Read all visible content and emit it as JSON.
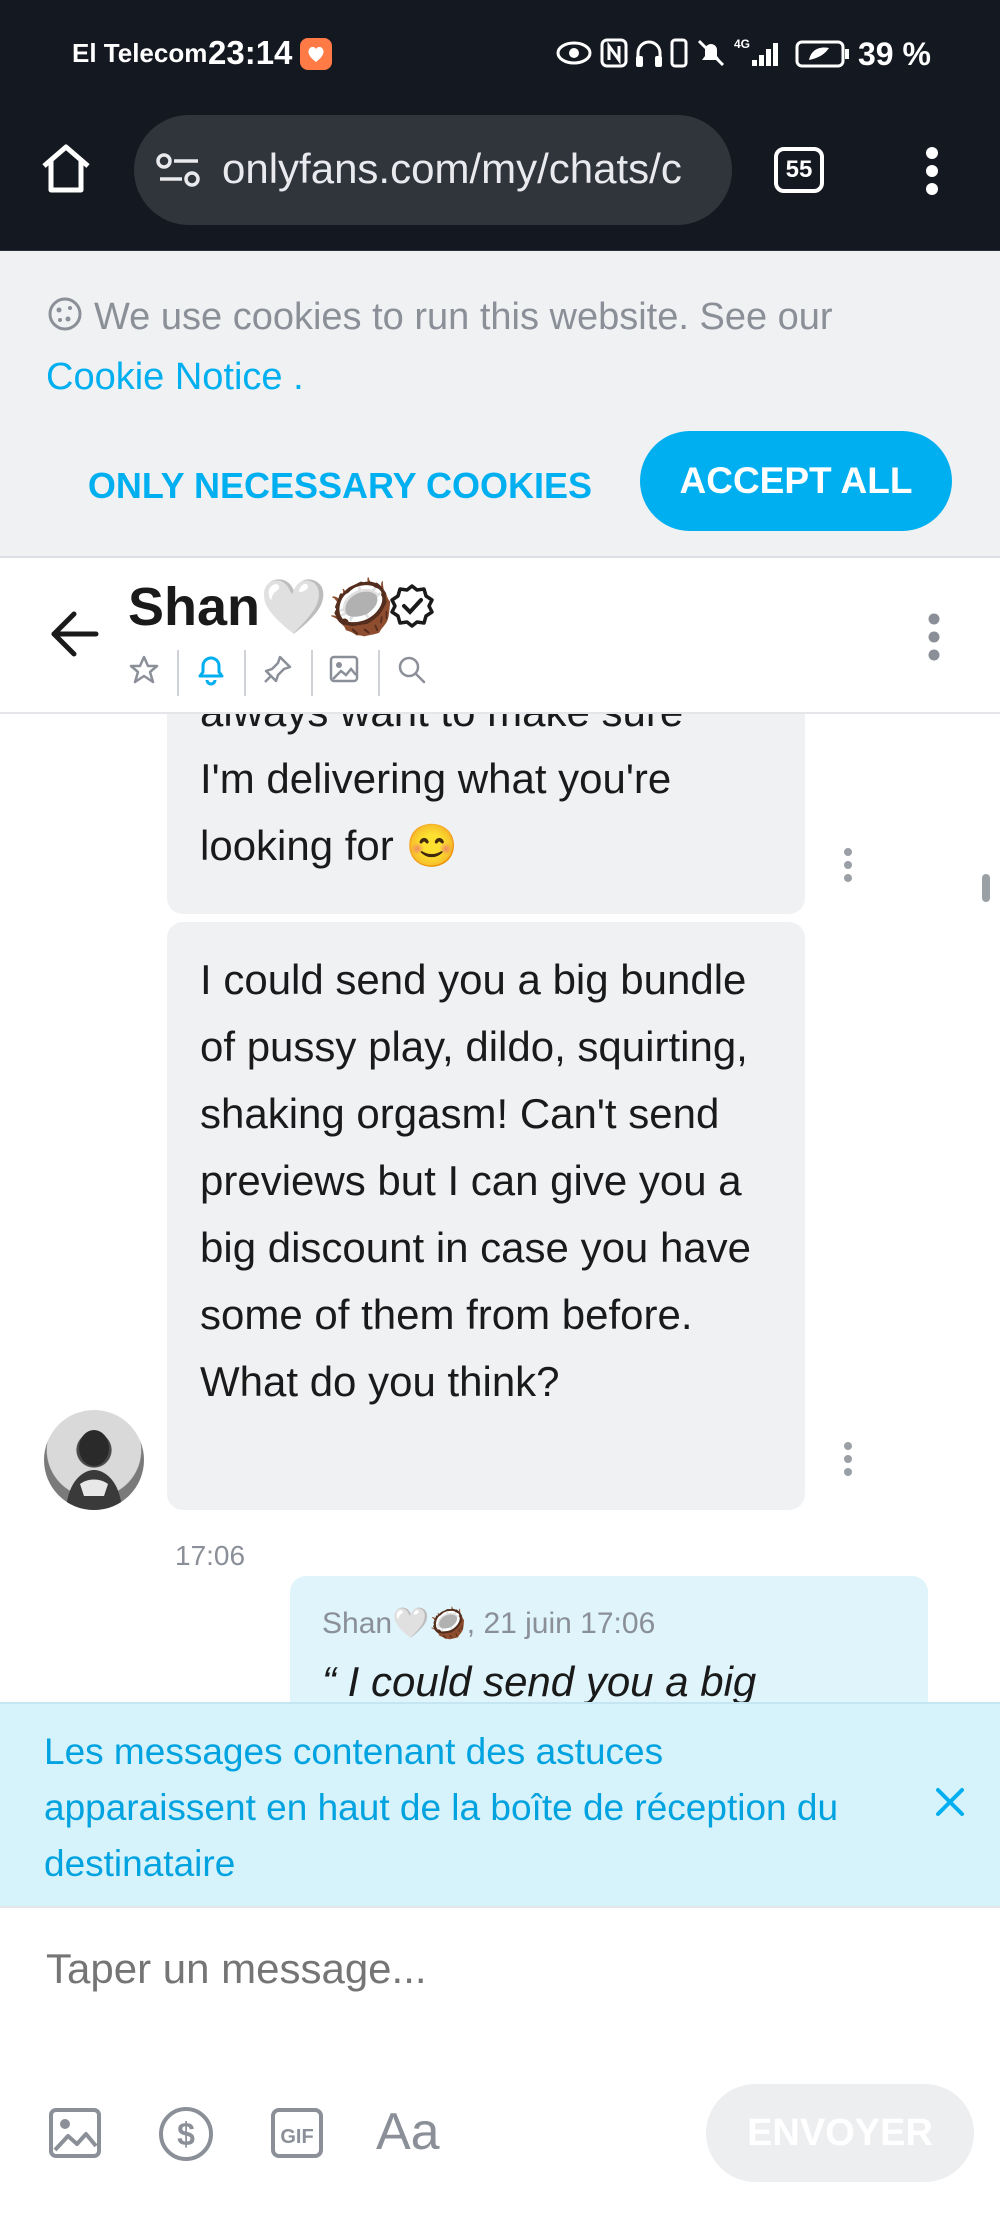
{
  "status_bar": {
    "carrier": "El Telecom",
    "time": "23:14",
    "battery": "39 %"
  },
  "browser": {
    "url": "onlyfans.com/my/chats/c",
    "tab_count": "55"
  },
  "cookie_banner": {
    "text": "We use cookies to run this website. See our",
    "link": "Cookie Notice",
    "link_suffix": " .",
    "necessary_button": "ONLY NECESSARY COOKIES",
    "accept_button": "ACCEPT ALL"
  },
  "chat_header": {
    "name": "Shan🤍🥥"
  },
  "messages": {
    "msg1_line_cut": "always want to make sure",
    "msg1_rest": "I'm delivering what you're looking for 😊",
    "msg2": "I could send you a big bundle of pussy play, dildo, squirting, shaking orgasm! Can't send previews but I can give you a big discount in case you have some of them from before. What do you think?",
    "time": "17:06",
    "quote_meta": "Shan🤍🥥, 21 juin 17:06",
    "quote_text": "“ I could send you a big"
  },
  "hint": {
    "text": "Les messages contenant des astuces apparaissent en haut de la boîte de réception du destinataire"
  },
  "composer": {
    "placeholder": "Taper un message...",
    "font_label": "Aa",
    "send_label": "ENVOYER"
  },
  "colors": {
    "accent": "#00aff0",
    "chrome": "#141820",
    "bubble": "#f0f1f3",
    "hint_bg": "#d6f2fb"
  }
}
